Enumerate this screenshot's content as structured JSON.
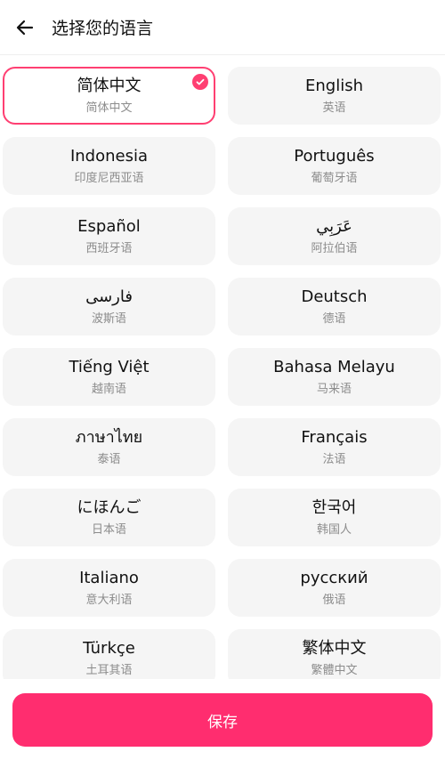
{
  "header": {
    "title": "选择您的语言",
    "back_icon": "arrow-left-icon"
  },
  "languages": [
    {
      "name": "简体中文",
      "sub": "简体中文",
      "selected": true
    },
    {
      "name": "English",
      "sub": "英语",
      "selected": false
    },
    {
      "name": "Indonesia",
      "sub": "印度尼西亚语",
      "selected": false
    },
    {
      "name": "Português",
      "sub": "葡萄牙语",
      "selected": false
    },
    {
      "name": "Español",
      "sub": "西班牙语",
      "selected": false
    },
    {
      "name": "عَرَبِي",
      "sub": "阿拉伯语",
      "selected": false
    },
    {
      "name": "فارسی",
      "sub": "波斯语",
      "selected": false
    },
    {
      "name": "Deutsch",
      "sub": "德语",
      "selected": false
    },
    {
      "name": "Tiếng Việt",
      "sub": "越南语",
      "selected": false
    },
    {
      "name": "Bahasa Melayu",
      "sub": "马来语",
      "selected": false
    },
    {
      "name": "ภาษาไทย",
      "sub": "泰语",
      "selected": false
    },
    {
      "name": "Français",
      "sub": "法语",
      "selected": false
    },
    {
      "name": "にほんご",
      "sub": "日本语",
      "selected": false
    },
    {
      "name": "한국어",
      "sub": "韩国人",
      "selected": false
    },
    {
      "name": "Italiano",
      "sub": "意大利语",
      "selected": false
    },
    {
      "name": "русский",
      "sub": "俄语",
      "selected": false
    },
    {
      "name": "Türkçe",
      "sub": "土耳其语",
      "selected": false
    },
    {
      "name": "繁体中文",
      "sub": "繁體中文",
      "selected": false
    }
  ],
  "footer": {
    "save_label": "保存"
  },
  "colors": {
    "accent": "#ff2d6f",
    "card_bg": "#f5f5f5",
    "sub_text": "#8c8c8c"
  }
}
